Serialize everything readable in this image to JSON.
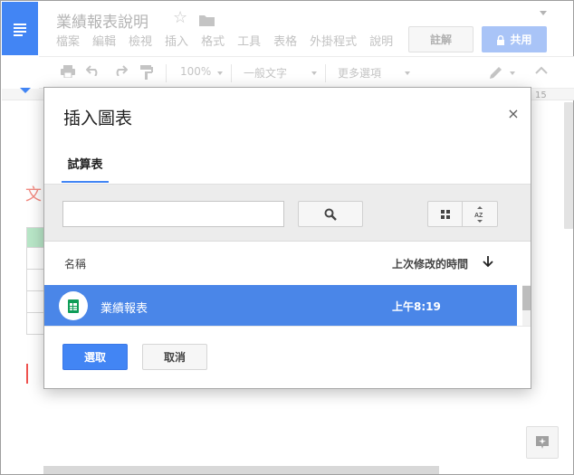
{
  "document": {
    "title": "業績報表說明",
    "menu": [
      "檔案",
      "編輯",
      "檢視",
      "插入",
      "格式",
      "工具",
      "表格",
      "外掛程式",
      "說明"
    ],
    "comment_label": "註解",
    "share_label": "共用",
    "toolbar": {
      "zoom": "100%",
      "style": "一般文字",
      "more": "更多選項"
    },
    "ruler_end": "15",
    "page_fragment_char": "文"
  },
  "dialog": {
    "title": "插入圖表",
    "close_glyph": "×",
    "tab_label": "試算表",
    "search": {
      "value": "",
      "placeholder": ""
    },
    "columns": {
      "name": "名稱",
      "modified": "上次修改的時間"
    },
    "files": [
      {
        "name": "業績報表",
        "modified": "上午8:19",
        "icon": "sheets-icon",
        "selected": true
      }
    ],
    "buttons": {
      "select": "選取",
      "cancel": "取消"
    }
  },
  "colors": {
    "brand_blue": "#4285f4",
    "selection_blue": "#4a86e8",
    "sheets_green": "#0f9d58"
  }
}
